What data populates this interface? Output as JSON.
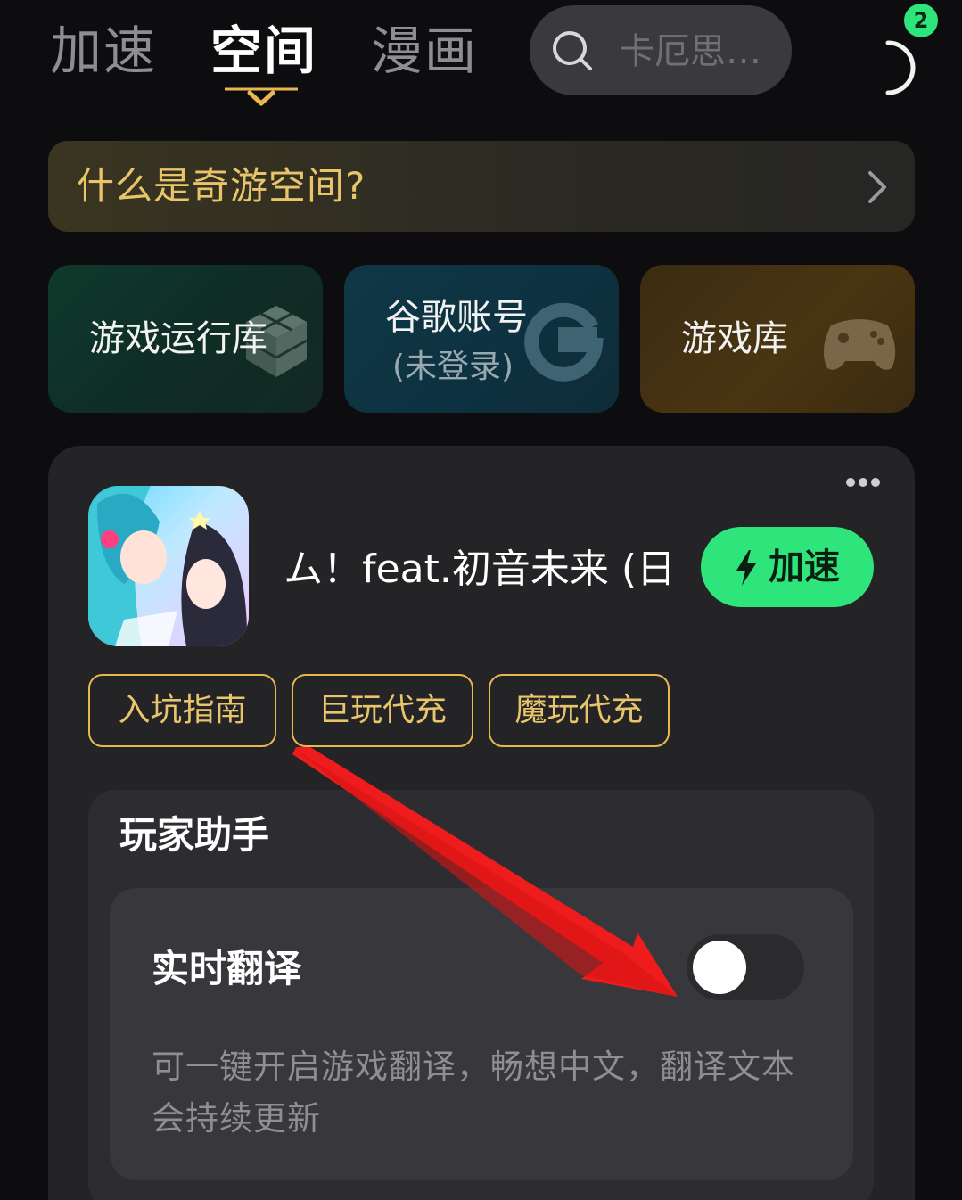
{
  "nav": {
    "tabs": [
      {
        "label": "加速"
      },
      {
        "label": "空间"
      },
      {
        "label": "漫画"
      }
    ],
    "active_tab": "空间",
    "search": {
      "placeholder": "卡厄思…"
    },
    "notification_count": "2"
  },
  "banner": {
    "text": "什么是奇游空间?"
  },
  "cards": [
    {
      "title": "游戏运行库",
      "icon": "cube-icon"
    },
    {
      "title": "谷歌账号",
      "subtitle": "(未登录)",
      "icon": "google-g-icon"
    },
    {
      "title": "游戏库",
      "icon": "gamepad-icon"
    }
  ],
  "game": {
    "title_visible": "ム！feat.初音未来 (日",
    "boost_label": "加速",
    "tags": [
      "入坑指南",
      "巨玩代充",
      "魔玩代充"
    ]
  },
  "assistant": {
    "title": "玩家助手",
    "feature": {
      "title": "实时翻译",
      "toggle_on": false,
      "description": "可一键开启游戏翻译，畅想中文，翻译文本会持续更新"
    }
  },
  "colors": {
    "background": "#0d0d0f",
    "accent_green": "#2ee57c",
    "accent_gold": "#e8c46a",
    "panel": "#242427",
    "annotation_red": "#ee1c1c"
  }
}
